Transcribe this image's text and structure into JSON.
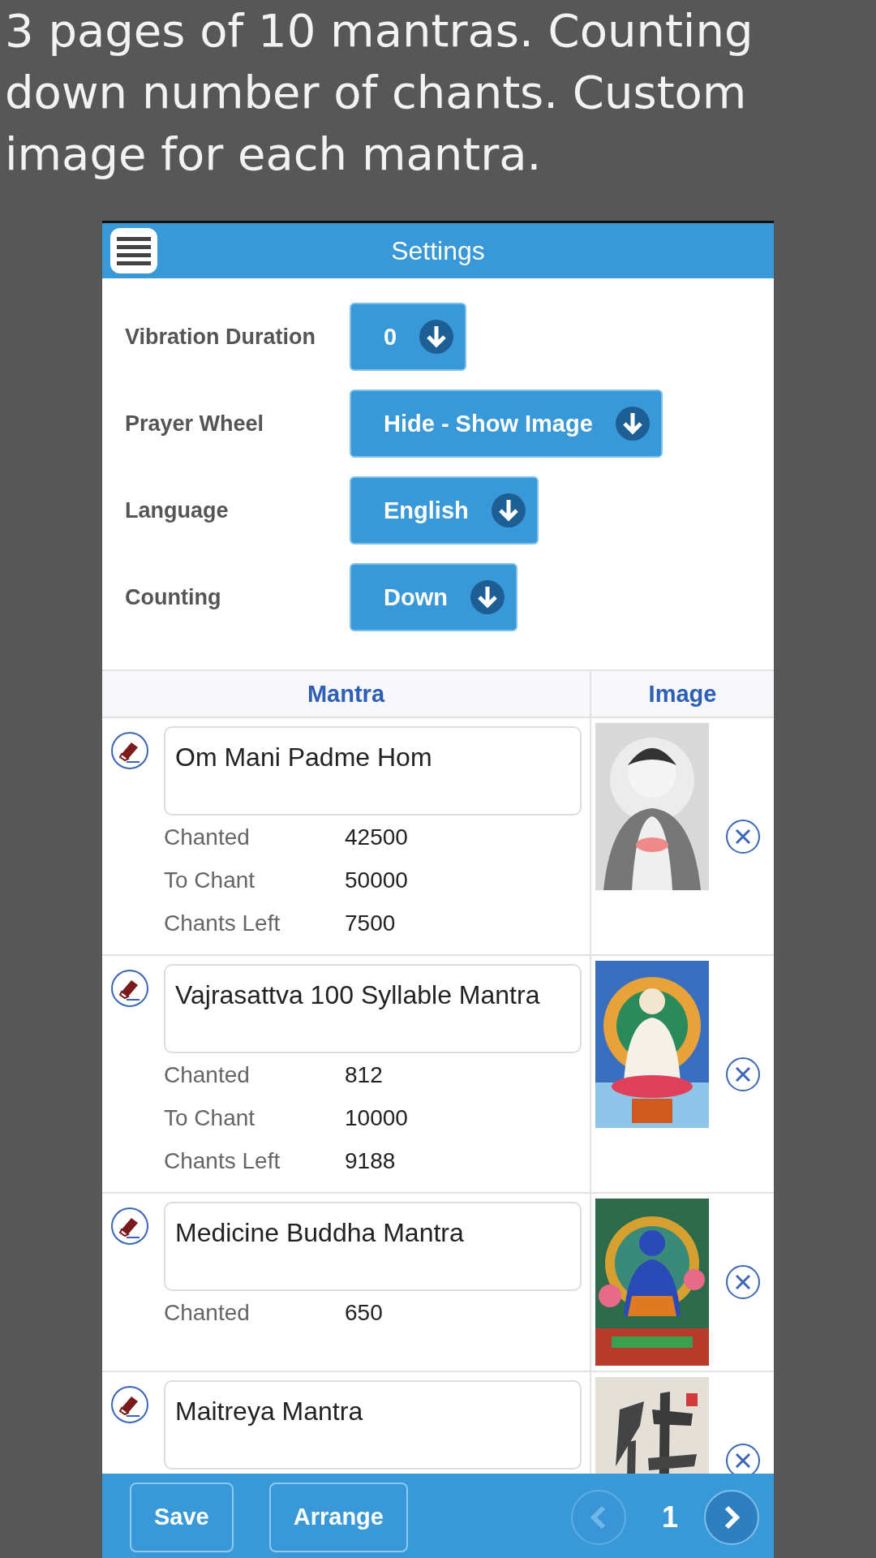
{
  "caption_lines": [
    "3 pages of 10 mantras. Counting",
    "down number of chants. Custom",
    "image for each mantra."
  ],
  "header": {
    "title": "Settings"
  },
  "settings": [
    {
      "label": "Vibration Duration",
      "value": "0"
    },
    {
      "label": "Prayer Wheel",
      "value": "Hide - Show Image"
    },
    {
      "label": "Language",
      "value": "English"
    },
    {
      "label": "Counting",
      "value": "Down"
    }
  ],
  "table": {
    "columns": [
      "Mantra",
      "Image"
    ],
    "rows": [
      {
        "name": "Om Mani Padme Hom",
        "image": {
          "kind": "picture"
        },
        "counts": [
          {
            "label": "Chanted",
            "value": "42500"
          },
          {
            "label": "To Chant",
            "value": "50000"
          },
          {
            "label": "Chants Left",
            "value": "7500"
          }
        ]
      },
      {
        "name": "Vajrasattva 100 Syllable Mantra",
        "image": {
          "kind": "picture"
        },
        "counts": [
          {
            "label": "Chanted",
            "value": "812"
          },
          {
            "label": "To Chant",
            "value": "10000"
          },
          {
            "label": "Chants Left",
            "value": "9188"
          }
        ]
      },
      {
        "name": "Medicine Buddha Mantra",
        "image": {
          "kind": "picture"
        },
        "counts": [
          {
            "label": "Chanted",
            "value": "650"
          }
        ]
      },
      {
        "name": "Maitreya Mantra",
        "image": {
          "kind": "picture"
        },
        "counts": []
      }
    ]
  },
  "footer": {
    "buttons": [
      "Save",
      "Arrange"
    ],
    "page": "1",
    "prev_disabled": true,
    "next_disabled": false
  }
}
